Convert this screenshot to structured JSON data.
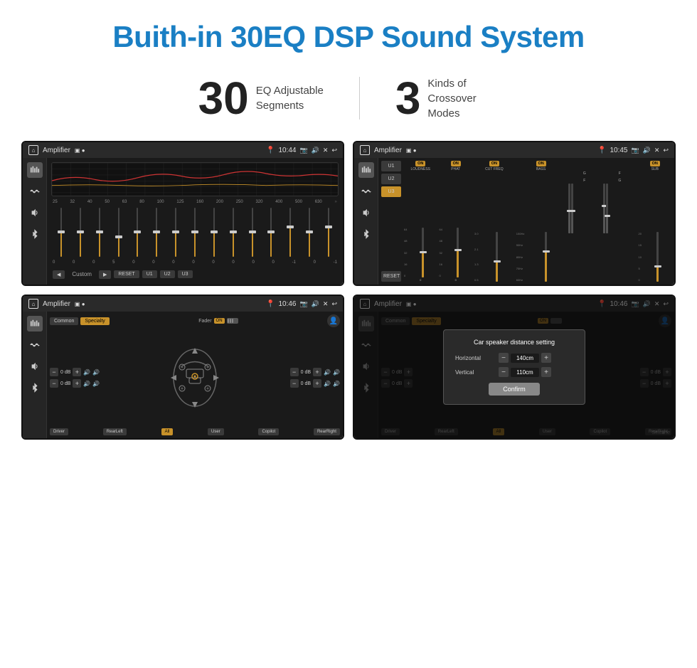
{
  "header": {
    "title": "Buith-in 30EQ DSP Sound System"
  },
  "stats": [
    {
      "number": "30",
      "label": "EQ Adjustable\nSegments"
    },
    {
      "number": "3",
      "label": "Kinds of\nCrossover Modes"
    }
  ],
  "screens": [
    {
      "id": "screen1",
      "statusBar": {
        "appName": "Amplifier",
        "time": "10:44"
      },
      "type": "eq-sliders",
      "freqs": [
        "25",
        "32",
        "40",
        "50",
        "63",
        "80",
        "100",
        "125",
        "160",
        "200",
        "250",
        "320",
        "400",
        "500",
        "630"
      ],
      "values": [
        "0",
        "0",
        "0",
        "5",
        "0",
        "0",
        "0",
        "0",
        "0",
        "0",
        "0",
        "0",
        "-1",
        "0",
        "-1"
      ],
      "sliderPositions": [
        50,
        50,
        50,
        40,
        50,
        50,
        50,
        50,
        50,
        50,
        50,
        50,
        60,
        50,
        60
      ],
      "presets": [
        "◀",
        "Custom",
        "▶",
        "RESET",
        "U1",
        "U2",
        "U3"
      ]
    },
    {
      "id": "screen2",
      "statusBar": {
        "appName": "Amplifier",
        "time": "10:45"
      },
      "type": "crossover",
      "presets": [
        "U1",
        "U2",
        "U3"
      ],
      "activePreset": "U3",
      "channels": [
        {
          "name": "LOUDNESS",
          "on": true,
          "labels": [
            "64",
            "48",
            "32",
            "16",
            "0"
          ]
        },
        {
          "name": "PHAT",
          "on": true,
          "labels": [
            "64",
            "48",
            "32",
            "16",
            "0"
          ]
        },
        {
          "name": "CUT FREQ",
          "on": true,
          "labels": [
            "3.0",
            "2.1",
            "1.3",
            "0.5"
          ]
        },
        {
          "name": "BASS",
          "on": true,
          "labels": [
            "100Hz",
            "90Hz",
            "80Hz",
            "70Hz",
            "60Hz"
          ]
        },
        {
          "name": "",
          "on": false,
          "labels": [
            "F",
            "G"
          ]
        },
        {
          "name": "",
          "on": false,
          "labels": [
            "F",
            "G"
          ]
        },
        {
          "name": "SUB",
          "on": true,
          "labels": [
            "20",
            "15",
            "10",
            "5",
            "0"
          ]
        }
      ],
      "resetLabel": "RESET"
    },
    {
      "id": "screen3",
      "statusBar": {
        "appName": "Amplifier",
        "time": "10:46"
      },
      "type": "speaker",
      "presetRow": [
        "Common",
        "Specialty"
      ],
      "activePreset": "Specialty",
      "faderLabel": "Fader",
      "faderOn": true,
      "dbValues": [
        "0 dB",
        "0 dB",
        "0 dB",
        "0 dB"
      ],
      "positions": [
        "Driver",
        "Copilot",
        "RearLeft",
        "All",
        "User",
        "RearRight"
      ],
      "activePosition": "All"
    },
    {
      "id": "screen4",
      "statusBar": {
        "appName": "Amplifier",
        "time": "10:46"
      },
      "type": "speaker-dialog",
      "dialog": {
        "title": "Car speaker distance setting",
        "horizontal": {
          "label": "Horizontal",
          "value": "140cm"
        },
        "vertical": {
          "label": "Vertical",
          "value": "110cm"
        },
        "confirmLabel": "Confirm"
      },
      "presetRow": [
        "Common",
        "Specialty"
      ],
      "activePreset": "Specialty",
      "dbValues": [
        "0 dB",
        "0 dB"
      ],
      "positions": [
        "Driver",
        "Copilot",
        "RearLeft",
        "All",
        "User",
        "RearRight"
      ],
      "activePosition": "All"
    }
  ],
  "watermark": "Seicane"
}
